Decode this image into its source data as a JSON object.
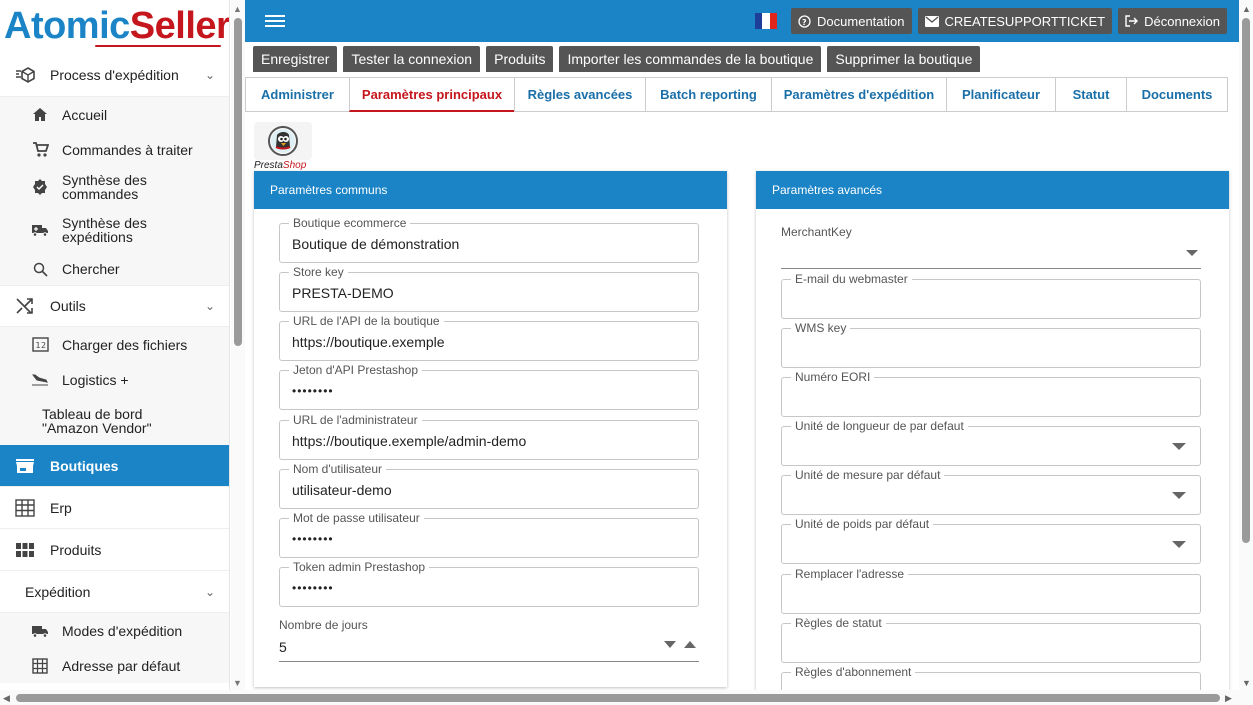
{
  "brand": {
    "part1": "Atomic",
    "part2": "Seller"
  },
  "sidebar": {
    "process_label": "Process d'expédition",
    "process_items": [
      {
        "label": "Accueil",
        "icon": "home-icon"
      },
      {
        "label": "Commandes à traiter",
        "icon": "cart-icon"
      },
      {
        "label": "Synthèse des commandes",
        "icon": "badge-icon"
      },
      {
        "label": "Synthèse des expéditions",
        "icon": "truck-icon"
      },
      {
        "label": "Chercher",
        "icon": "search-icon"
      }
    ],
    "tools_label": "Outils",
    "tools_items": [
      {
        "label": "Charger des fichiers",
        "icon": "upload-icon"
      },
      {
        "label": "Logistics +",
        "icon": "plane-icon"
      },
      {
        "label": "Tableau de bord \"Amazon Vendor\"",
        "icon": ""
      }
    ],
    "boutiques_label": "Boutiques",
    "erp_label": "Erp",
    "produits_label": "Produits",
    "expedition_label": "Expédition",
    "expedition_items": [
      {
        "label": "Modes d'expédition",
        "icon": "truck-icon"
      },
      {
        "label": "Adresse par défaut",
        "icon": "grid-icon"
      }
    ]
  },
  "topbar": {
    "documentation": "Documentation",
    "support": "CREATESUPPORTTICKET",
    "logout": "Déconnexion"
  },
  "actions": [
    "Enregistrer",
    "Tester la connexion",
    "Produits",
    "Importer les commandes de la boutique",
    "Supprimer la boutique"
  ],
  "tabs": [
    "Administrer",
    "Paramètres principaux",
    "Règles avancées",
    "Batch reporting",
    "Paramètres d'expédition",
    "Planificateur",
    "Statut",
    "Documents"
  ],
  "active_tab": "Paramètres principaux",
  "presta_logo": {
    "part1": "Presta",
    "part2": "Shop"
  },
  "common": {
    "title": "Paramètres communs",
    "fields": [
      {
        "label": "Boutique ecommerce",
        "value": "Boutique de démonstration"
      },
      {
        "label": "Store key",
        "value": "PRESTA-DEMO"
      },
      {
        "label": "URL de l'API de la boutique",
        "value": "https://boutique.exemple"
      },
      {
        "label": "Jeton d'API Prestashop",
        "value": "••••••••"
      },
      {
        "label": "URL de l'administrateur",
        "value": "https://boutique.exemple/admin-demo"
      },
      {
        "label": "Nom d'utilisateur",
        "value": "utilisateur-demo"
      },
      {
        "label": "Mot de passe utilisateur",
        "value": "••••••••"
      },
      {
        "label": "Token admin Prestashop",
        "value": "••••••••"
      }
    ],
    "days_label": "Nombre de jours",
    "days_value": "5"
  },
  "advanced": {
    "title": "Paramètres avancés",
    "merchant_label": "MerchantKey",
    "fields": [
      {
        "label": "E-mail du webmaster",
        "select": false
      },
      {
        "label": "WMS key",
        "select": false
      },
      {
        "label": "Numéro EORI",
        "select": false
      },
      {
        "label": "Unité de longueur de par defaut",
        "select": true
      },
      {
        "label": "Unité de mesure par défaut",
        "select": true
      },
      {
        "label": "Unité de poids par défaut",
        "select": true
      },
      {
        "label": "Remplacer l'adresse",
        "select": false
      },
      {
        "label": "Règles de statut",
        "select": false
      },
      {
        "label": "Règles d'abonnement",
        "select": false
      }
    ]
  },
  "colors": {
    "primary": "#1a84c6",
    "brand_red": "#c4161c",
    "button_gray": "#555555"
  }
}
